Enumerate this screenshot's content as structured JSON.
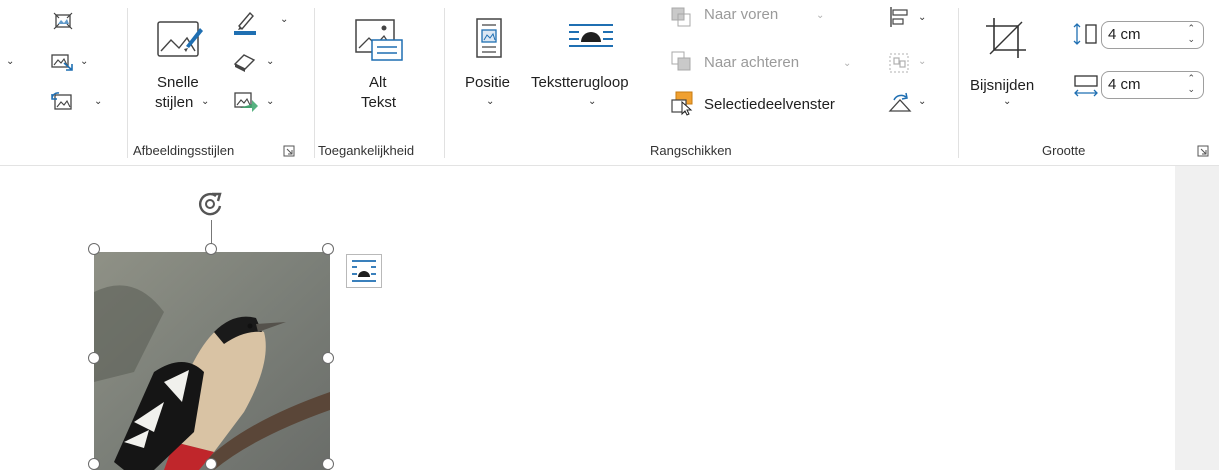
{
  "ribbon": {
    "groups": {
      "styles": {
        "label": "Afbeeldingsstijlen"
      },
      "accessibility": {
        "label": "Toegankelijkheid"
      },
      "arrange": {
        "label": "Rangschikken"
      },
      "size": {
        "label": "Grootte"
      }
    },
    "buttons": {
      "quick_styles": {
        "line1": "Snelle",
        "line2": "stijlen"
      },
      "alt_text": {
        "line1": "Alt",
        "line2": "Tekst"
      },
      "position": {
        "label": "Positie"
      },
      "wrap_text": {
        "label": "Tekstterugloop"
      },
      "bring_forward": {
        "label": "Naar voren"
      },
      "send_backward": {
        "label": "Naar achteren"
      },
      "selection_pane": {
        "label": "Selectiedeelvenster"
      },
      "crop": {
        "label": "Bijsnijden"
      }
    },
    "size_fields": {
      "height": {
        "value": "4 cm"
      },
      "width": {
        "value": "4 cm"
      }
    }
  },
  "colors": {
    "accent_blue": "#1f6fb2",
    "disabled": "#9a9a9a"
  }
}
